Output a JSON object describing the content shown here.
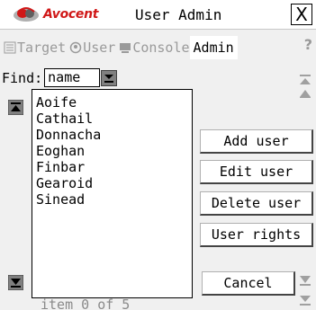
{
  "titlebar": {
    "brand": "Avocent",
    "title": "User Admin",
    "close": "X"
  },
  "tabs": [
    {
      "label": "Target",
      "icon": "target-icon",
      "active": false
    },
    {
      "label": "User",
      "icon": "user-icon",
      "active": false
    },
    {
      "label": "Console",
      "icon": "console-icon",
      "active": false
    },
    {
      "label": "Admin",
      "icon": "",
      "active": true
    }
  ],
  "help": "?",
  "find": {
    "label": "Find:",
    "value": "name"
  },
  "users": [
    "Aoife",
    "Cathail",
    "Donnacha",
    "Eoghan",
    "Finbar",
    "Gearoid",
    "Sinead"
  ],
  "actions": {
    "add": "Add user",
    "edit": "Edit user",
    "delete": "Delete user",
    "rights": "User rights",
    "cancel": "Cancel"
  },
  "status": "item 0 of 5",
  "colors": {
    "brand": "#d01818",
    "scroll": "#808080"
  }
}
